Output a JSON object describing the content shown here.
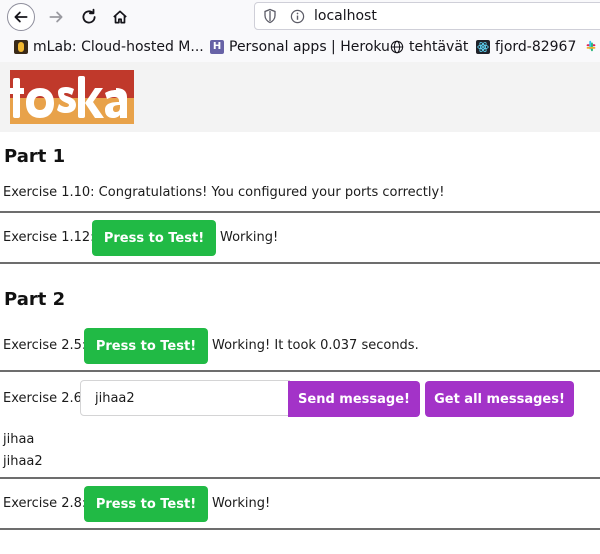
{
  "browser": {
    "url": "localhost",
    "bookmarks": [
      {
        "label": "mLab: Cloud-hosted M..."
      },
      {
        "label": "Personal apps | Heroku"
      },
      {
        "label": "tehtävät"
      },
      {
        "label": "fjord-82967"
      }
    ]
  },
  "logo": {
    "text": "toska"
  },
  "part1": {
    "title": "Part 1",
    "ex110": {
      "text": "Exercise 1.10: Congratulations! You configured your ports correctly!"
    },
    "ex112": {
      "label": "Exercise 1.12:",
      "button": "Press to Test!",
      "status": "Working!"
    }
  },
  "part2": {
    "title": "Part 2",
    "ex25": {
      "label": "Exercise 2.5:",
      "button": "Press to Test!",
      "status": "Working! It took 0.037 seconds."
    },
    "ex26": {
      "label": "Exercise 2.6:",
      "input_value": "jihaa2",
      "send_button": "Send message!",
      "get_button": "Get all messages!"
    },
    "messages": [
      "jihaa",
      "jihaa2"
    ],
    "ex28": {
      "label": "Exercise 2.8:",
      "button": "Press to Test!",
      "status": "Working!"
    }
  },
  "colors": {
    "green": "#21ba45",
    "purple": "#a333c8",
    "logo_orange": "#e8a24a",
    "logo_red": "#c0392b"
  }
}
